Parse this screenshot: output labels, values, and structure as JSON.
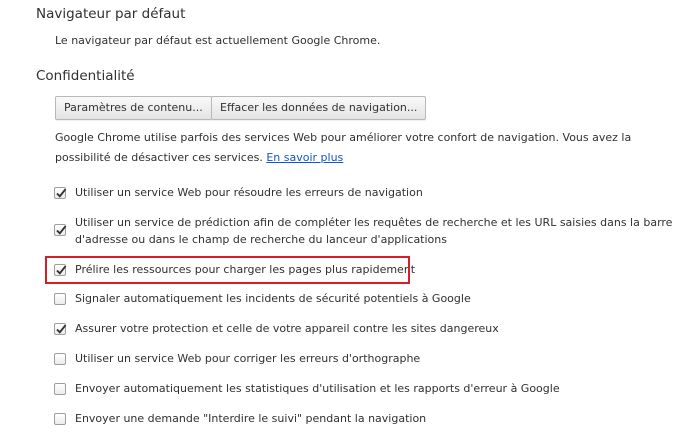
{
  "default_browser": {
    "title": "Navigateur par défaut",
    "description": "Le navigateur par défaut est actuellement Google Chrome."
  },
  "privacy": {
    "title": "Confidentialité",
    "content_settings_button": "Paramètres de contenu...",
    "clear_data_button": "Effacer les données de navigation...",
    "info_line1": "Google Chrome utilise parfois des services Web pour améliorer votre confort de navigation. Vous avez la",
    "info_line2": "possibilité de désactiver ces services.",
    "learn_more": "En savoir plus",
    "options": [
      {
        "label": "Utiliser un service Web pour résoudre les erreurs de navigation",
        "checked": true
      },
      {
        "label_line1": "Utiliser un service de prédiction afin de compléter les requêtes de recherche et les URL saisies dans la barre",
        "label_line2": "d'adresse ou dans le champ de recherche du lanceur d'applications",
        "checked": true
      },
      {
        "label": "Prélire les ressources pour charger les pages plus rapidement",
        "checked": true
      },
      {
        "label": "Signaler automatiquement les incidents de sécurité potentiels à Google",
        "checked": false
      },
      {
        "label": "Assurer votre protection et celle de votre appareil contre les sites dangereux",
        "checked": true
      },
      {
        "label": "Utiliser un service Web pour corriger les erreurs d'orthographe",
        "checked": false
      },
      {
        "label": "Envoyer automatiquement les statistiques d'utilisation et les rapports d'erreur à Google",
        "checked": false
      },
      {
        "label": "Envoyer une demande \"Interdire le suivi\" pendant la navigation",
        "checked": false
      }
    ]
  },
  "colors": {
    "highlight_border": "#d3202a",
    "link": "#1155cc"
  }
}
